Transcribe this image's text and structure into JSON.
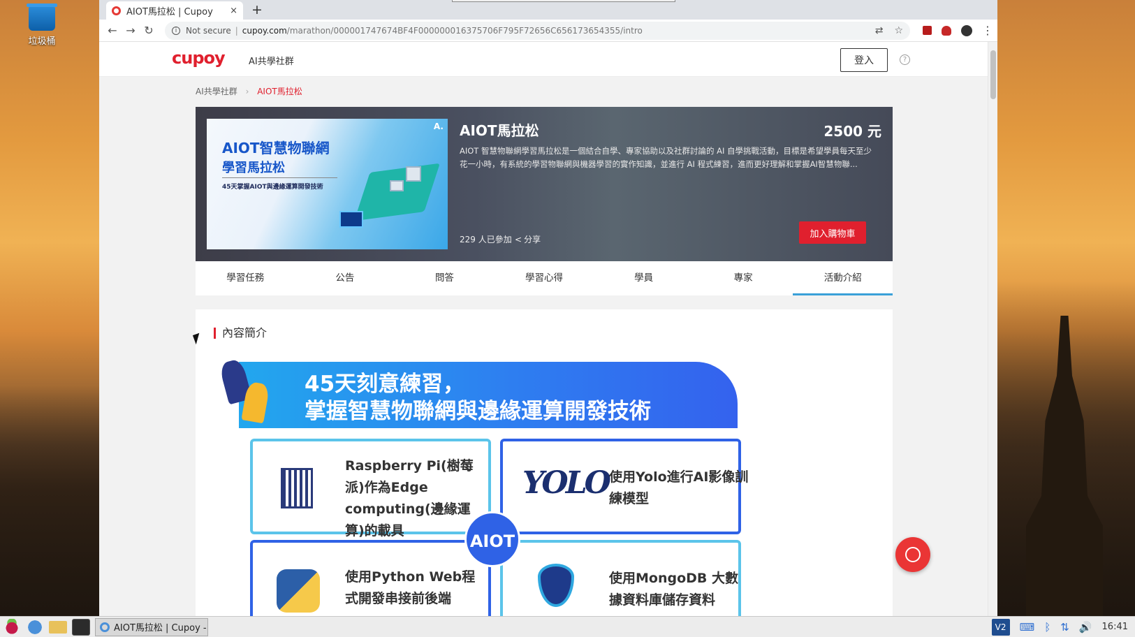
{
  "desktop": {
    "trash_label": "垃圾桶"
  },
  "browser": {
    "tab": {
      "title": "AIOT馬拉松 | Cupoy",
      "close": "×",
      "new_tab": "+"
    },
    "nav": {
      "back": "←",
      "forward": "→",
      "reload": "↻"
    },
    "address": {
      "security_label": "Not secure",
      "separator": "|",
      "host": "cupoy.com",
      "path": "/marathon/000001747674BF4F000000016375706F795F72656C656173654355/intro"
    },
    "actions": {
      "translate": "⇄",
      "bookmark": "☆",
      "menu": "⋮"
    }
  },
  "site": {
    "logo": "cupoy",
    "brand_nav": "AI共學社群",
    "login_label": "登入",
    "help_icon": "?"
  },
  "breadcrumb": {
    "items": [
      "AI共學社群",
      "AIOT馬拉松"
    ],
    "separator": "›"
  },
  "hero": {
    "image": {
      "line1": "AIOT智慧物聯網",
      "line2": "學習馬拉松",
      "line3": "45天掌握AIOT與邊緣運算開發技術",
      "badge": "A."
    },
    "title": "AIOT馬拉松",
    "price": "2500 元",
    "description": "AIOT 智慧物聯網學習馬拉松是一個結合自學、專家協助以及社群討論的 AI 自學挑戰活動，目標是希望學員每天至少花一小時，有系統的學習物聯網與機器學習的實作知識，並進行 AI 程式練習，進而更好理解和掌握AI智慧物聯...",
    "joined": "229 人已參加",
    "share": "分享",
    "cart_button": "加入購物車"
  },
  "tabs": [
    "學習任務",
    "公告",
    "問答",
    "學習心得",
    "學員",
    "專家",
    "活動介紹"
  ],
  "active_tab_index": 6,
  "content": {
    "section_title": "內容簡介",
    "banner": {
      "line1": "45天刻意練習，",
      "line2": "掌握智慧物聯網與邊緣運算開發技術",
      "center_badge": "AIOT",
      "cards": [
        "Raspberry Pi(樹莓派)作為Edge computing(邊緣運算)的載具",
        "使用Yolo進行AI影像訓練模型",
        "使用Python Web程式開發串接前後端",
        "使用MongoDB 大數據資料庫儲存資料"
      ],
      "yolo_text": "YOLO"
    }
  },
  "taskbar": {
    "task_label": "AIOT馬拉松 | Cupoy - ...",
    "vnc": "V2",
    "clock": "16:41"
  },
  "colors": {
    "accent": "#e0202e",
    "tab_underline": "#3aa0d8",
    "banner_blue": "#2f62e6"
  }
}
